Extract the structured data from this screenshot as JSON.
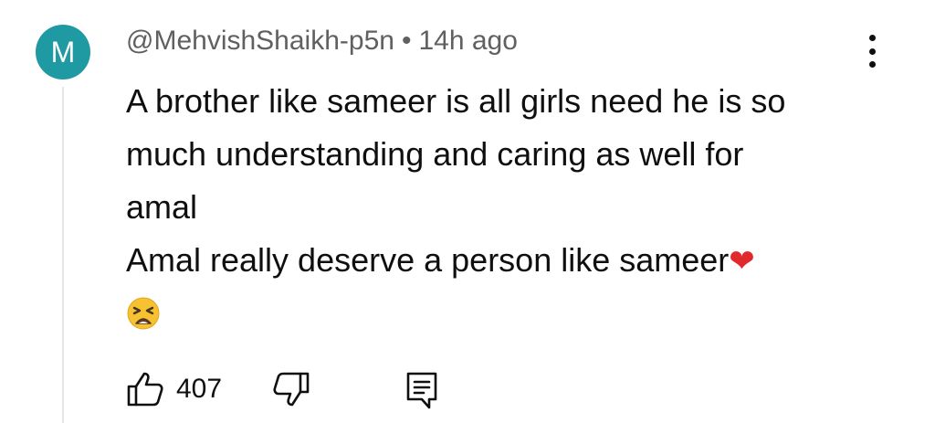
{
  "comment": {
    "avatar_letter": "M",
    "avatar_color": "#1f9aa3",
    "author": "@MehvishShaikh-p5n",
    "separator": "•",
    "time": "14h ago",
    "lines": [
      "A brother like sameer is all girls need he is so",
      "much understanding and caring as well for",
      "amal",
      "Amal really deserve a person like sameer"
    ],
    "heart_emoji": "❤",
    "face_emoji": "😫",
    "like_count": "407",
    "icons": {
      "menu": "more-vert-icon",
      "like": "thumbs-up-icon",
      "dislike": "thumbs-down-icon",
      "reply": "comment-icon"
    }
  }
}
